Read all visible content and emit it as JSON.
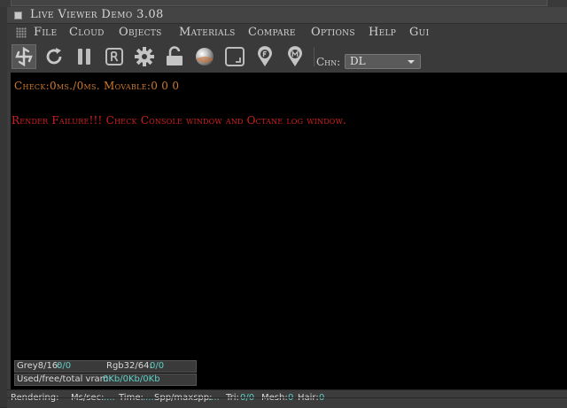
{
  "window": {
    "title": "Live Viewer Demo 3.08"
  },
  "menu": [
    "File",
    "Cloud",
    "Objects",
    "Materials",
    "Compare",
    "Options",
    "Help",
    "Gui"
  ],
  "toolbar": {
    "buttons": [
      {
        "name": "clay-mode-icon"
      },
      {
        "name": "refresh-icon"
      },
      {
        "name": "pause-icon"
      },
      {
        "name": "region-r-icon"
      },
      {
        "name": "gear-icon"
      },
      {
        "name": "lock-open-icon"
      },
      {
        "name": "sphere-material-icon"
      },
      {
        "name": "focus-frame-icon"
      },
      {
        "name": "pin-f-icon"
      },
      {
        "name": "pin-m-icon"
      }
    ],
    "channel_label": "Chn:",
    "channel_value": "DL"
  },
  "viewport": {
    "check_text": "Check:0ms./0ms. Movable:0  0 0",
    "error_text": "Render Failure!!! Check Console window and Octane log window."
  },
  "stats": {
    "grey_label": "Grey8/16:",
    "grey_value": "0/0",
    "rgb_label": "Rgb32/64:",
    "rgb_value": "0/0",
    "vram_label": "Used/free/total vram:",
    "vram_value": "0Kb/0Kb/0Kb"
  },
  "statusbar": {
    "rendering_label": "Rendering:",
    "ms_label": "Ms/sec:",
    "ms_value": "....",
    "time_label": "Time:",
    "time_value": "....",
    "spp_label": "Spp/maxspp:",
    "spp_value": "....",
    "tri_label": "Tri:",
    "tri_value": "0/0",
    "mesh_label": "Mesh:",
    "mesh_value": "0",
    "hair_label": "Hair:",
    "hair_value": "0"
  },
  "colors": {
    "check_text": "#d07a2a",
    "error_text": "#d22020",
    "stat_value": "#5fd0c8",
    "viewport_bg": "#000000"
  }
}
